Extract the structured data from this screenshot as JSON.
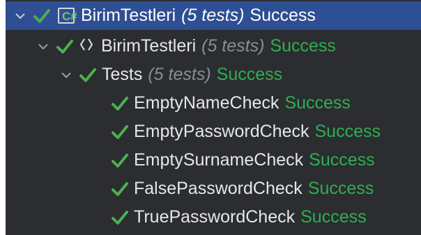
{
  "colors": {
    "panel_bg": "#2b2d30",
    "selection_bg": "#2e4f93",
    "success": "#2fae52",
    "muted": "#8a8d93",
    "check": "#4caf50"
  },
  "tree": {
    "root": {
      "icon": "csharp-project-icon",
      "name": "BirimTestleri",
      "count": "(5 tests)",
      "status": "Success"
    },
    "namespace": {
      "icon": "namespace-braces-icon",
      "glyph": "‹›",
      "name": "BirimTestleri",
      "count": "(5 tests)",
      "status": "Success"
    },
    "class": {
      "name": "Tests",
      "count": "(5 tests)",
      "status": "Success"
    },
    "tests": [
      {
        "name": "EmptyNameCheck",
        "status": "Success"
      },
      {
        "name": "EmptyPasswordCheck",
        "status": "Success"
      },
      {
        "name": "EmptySurnameCheck",
        "status": "Success"
      },
      {
        "name": "FalsePasswordCheck",
        "status": "Success"
      },
      {
        "name": "TruePasswordCheck",
        "status": "Success"
      }
    ]
  }
}
